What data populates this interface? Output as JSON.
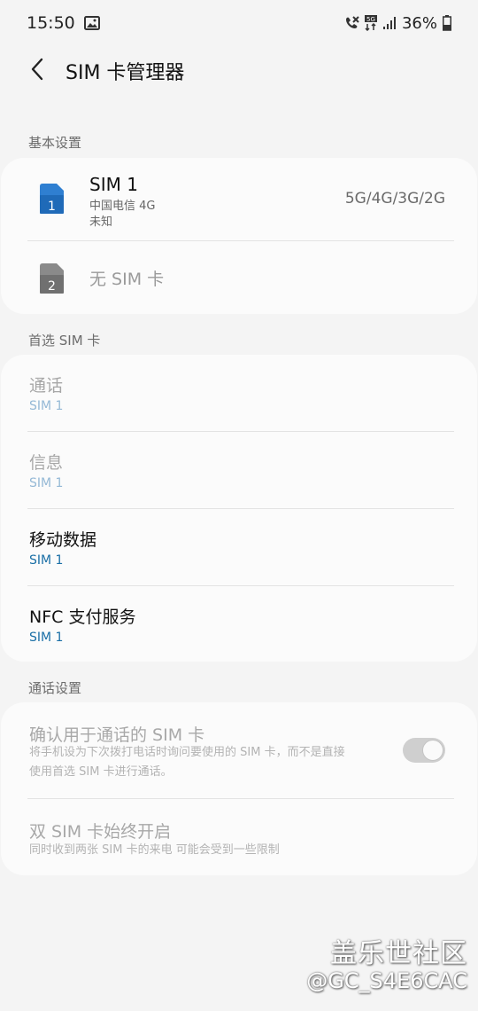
{
  "status_bar": {
    "time": "15:50",
    "battery": "36%",
    "icons": [
      "gallery-icon",
      "call-blocked-icon",
      "5g-icon",
      "signal-icon",
      "battery-icon"
    ]
  },
  "app_bar": {
    "title": "SIM 卡管理器"
  },
  "basic": {
    "section_label": "基本设置",
    "sim1": {
      "slot": "1",
      "name": "SIM 1",
      "carrier": "中国电信 4G",
      "number": "未知",
      "network": "5G/4G/3G/2G",
      "color": "#2f7fd1"
    },
    "sim2": {
      "slot": "2",
      "label": "无 SIM 卡",
      "color": "#7d7d7d"
    }
  },
  "preferred": {
    "section_label": "首选 SIM 卡",
    "items": [
      {
        "title": "通话",
        "value": "SIM 1"
      },
      {
        "title": "信息",
        "value": "SIM 1"
      },
      {
        "title": "移动数据",
        "value": "SIM 1"
      },
      {
        "title": "NFC 支付服务",
        "value": "SIM 1"
      }
    ]
  },
  "call_settings": {
    "section_label": "通话设置",
    "confirm": {
      "title": "确认用于通话的 SIM 卡",
      "desc_line1": "将手机设为下次拨打电话时询问要使用的 SIM 卡，而不是直接",
      "desc_line2": "使用首选 SIM 卡进行通话。",
      "toggle_on": true
    },
    "dual": {
      "title": "双 SIM 卡始终开启",
      "desc": "同时收到两张 SIM 卡的来电 可能会受到一些限制"
    }
  },
  "watermark": {
    "line1": "盖乐世社区",
    "line2": "@GC_S4E6CAC"
  }
}
